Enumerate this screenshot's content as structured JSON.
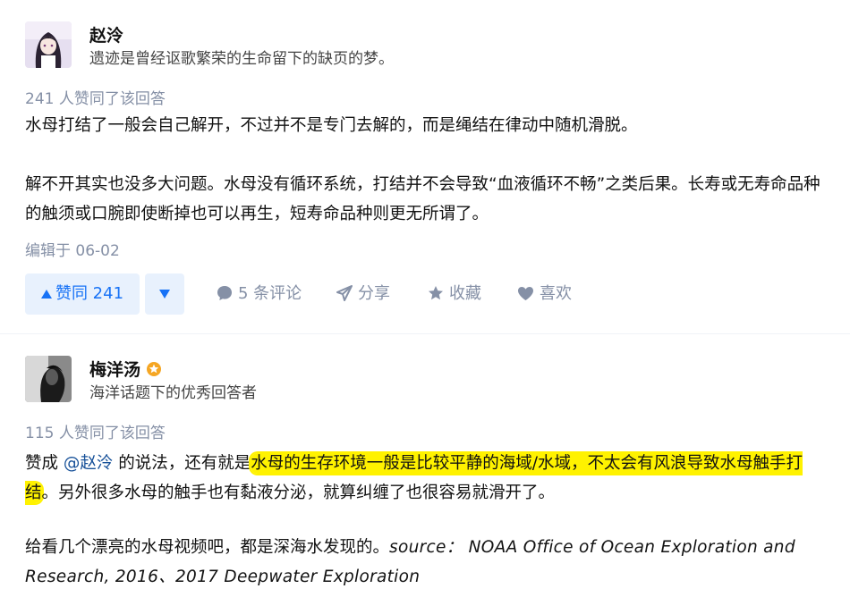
{
  "answers": [
    {
      "author": {
        "name": "赵泠",
        "bio": "遗迹是曾经讴歌繁荣的生命留下的缺页的梦。"
      },
      "votes_text": "241 人赞同了该回答",
      "paragraphs": [
        "水母打结了一般会自己解开，不过并不是专门去解的，而是绳结在律动中随机滑脱。",
        "解不开其实也没多大问题。水母没有循环系统，打结并不会导致“血液循环不畅”之类后果。长寿或无寿命品种的触须或口腕即使断掉也可以再生，短寿命品种则更无所谓了。"
      ],
      "edited": "编辑于 06-02",
      "actions": {
        "upvote": "赞同 241",
        "comments": "5 条评论",
        "share": "分享",
        "favorite": "收藏",
        "like": "喜欢"
      }
    },
    {
      "author": {
        "name": "梅洋汤",
        "bio": "海洋话题下的优秀回答者"
      },
      "votes_text": "115 人赞同了该回答",
      "p1": {
        "prefix": "赞成 ",
        "mention": "@赵泠",
        "middle": " 的说法，还有就是",
        "highlight": "水母的生存环境一般是比较平静的海域/水域，不太会有风浪导致水母触手打结",
        "suffix": "。另外很多水母的触手也有黏液分泌，就算纠缠了也很容易就滑开了。"
      },
      "p2": {
        "text": "给看几个漂亮的水母视频吧，都是深海水发现的。",
        "source": "source：  NOAA Office of Ocean Exploration and Research, 2016、2017 Deepwater Exploration"
      }
    }
  ],
  "colors": {
    "accent": "#1772f6",
    "vote_bg": "#e8f1fd",
    "meta": "#8590a6",
    "highlight": "#fff200",
    "badge": "#f5a623"
  },
  "icons": [
    "caret-up-icon",
    "caret-down-icon",
    "comment-icon",
    "share-icon",
    "star-icon",
    "heart-icon",
    "excellent-answerer-badge-icon"
  ]
}
